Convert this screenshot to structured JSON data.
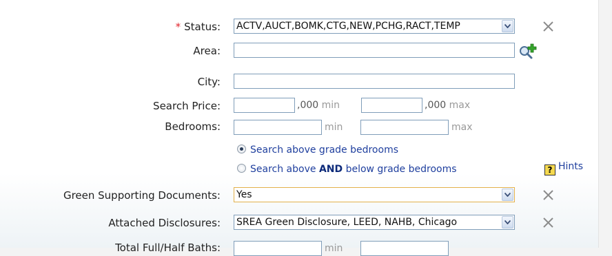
{
  "form": {
    "status": {
      "label": "Status:",
      "required_mark": "*",
      "value": "ACTV,AUCT,BOMK,CTG,NEW,PCHG,RACT,TEMP"
    },
    "area": {
      "label": "Area:",
      "value": ""
    },
    "city": {
      "label": "City:",
      "value": ""
    },
    "search_price": {
      "label": "Search Price:",
      "min_value": "",
      "max_value": "",
      "min_suffix": ",000",
      "min_unit": "min",
      "max_suffix": ",000",
      "max_unit": "max"
    },
    "bedrooms": {
      "label": "Bedrooms:",
      "min_value": "",
      "max_value": "",
      "min_unit": "min",
      "max_unit": "max"
    },
    "bedroom_options": {
      "option1": "Search above grade bedrooms",
      "option2_pre": "Search above ",
      "option2_bold": "AND",
      "option2_post": " below grade bedrooms",
      "selected": "option1",
      "help_glyph": "?",
      "hints_label": "Hints"
    },
    "green_docs": {
      "label": "Green Supporting Documents:",
      "value": "Yes"
    },
    "attached_disclosures": {
      "label": "Attached Disclosures:",
      "value": "SREA Green Disclosure, LEED, NAHB, Chicago"
    },
    "total_baths": {
      "label": "Total Full/Half Baths:",
      "min_unit": "min"
    }
  },
  "colors": {
    "accent_link": "#1f3f9e",
    "required": "#e1262d",
    "input_border": "#7f9db9",
    "highlight_border": "#e2b04a"
  },
  "icons": {
    "clear": "x-icon",
    "dropdown": "chevron-down-icon",
    "lookup": "magnifier-add-icon",
    "help": "help-icon"
  }
}
